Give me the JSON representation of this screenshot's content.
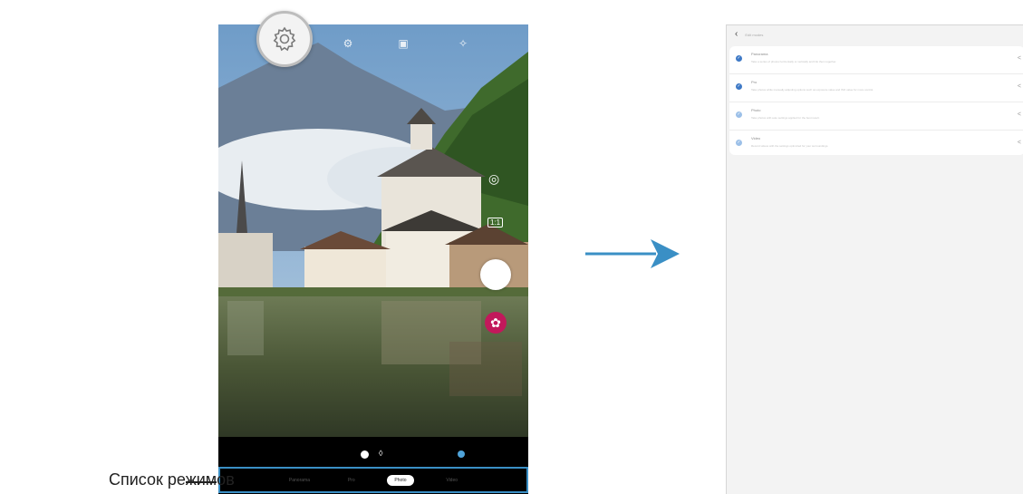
{
  "callout": {
    "label": "Список режимов"
  },
  "camera": {
    "modes": [
      "Panorama",
      "Pro",
      "Photo",
      "Video"
    ],
    "active_mode": "Photo"
  },
  "settings_screen": {
    "title": "Edit modes",
    "items": [
      {
        "label": "Panorama",
        "desc": "Take a series of photos horizontally or vertically and link them together.",
        "checked": true
      },
      {
        "label": "Pro",
        "desc": "Take photos while manually adjusting options such as exposure value and ISO value for more control.",
        "checked": true
      },
      {
        "label": "Photo",
        "desc": "Take photos with auto settings applied for the best result.",
        "checked": true
      },
      {
        "label": "Video",
        "desc": "Record videos with the settings optimized for your surroundings.",
        "checked": true
      }
    ]
  },
  "colors": {
    "accent": "#3a8fc5",
    "check": "#3e79c6",
    "gallery": "#c2185b"
  }
}
